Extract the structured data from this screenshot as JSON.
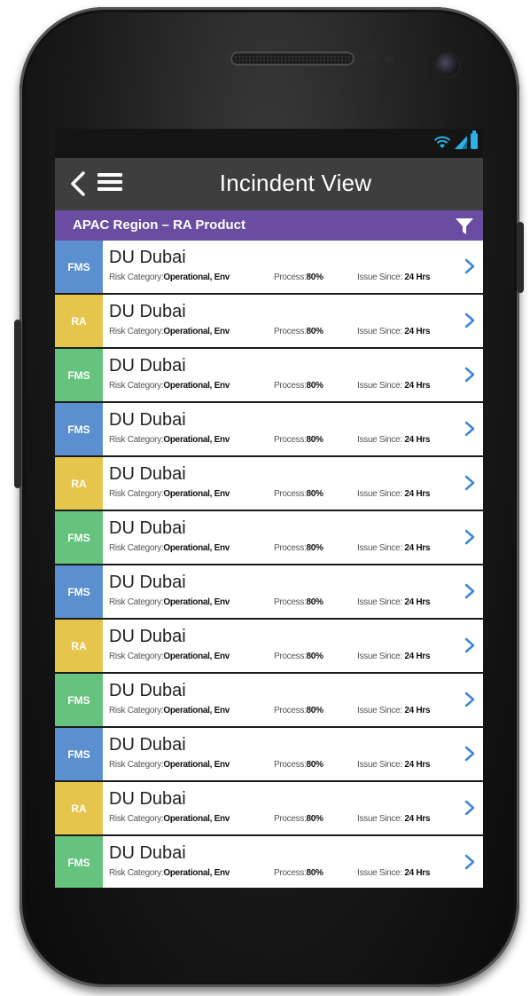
{
  "app": {
    "title": "Incindent View"
  },
  "filter": {
    "label": "APAC Region – RA Product"
  },
  "icons": {
    "back": "back-chevron-icon",
    "menu": "hamburger-menu-icon",
    "filter": "filter-funnel-icon",
    "row_chevron": "chevron-right-icon",
    "wifi": "wifi-icon",
    "signal": "cell-signal-icon",
    "battery": "battery-icon"
  },
  "colors": {
    "filter_bar": "#6a4da0",
    "app_bar": "#3e3e3e",
    "badge_blue": "#5b8fd0",
    "badge_yellow": "#e6c54c",
    "badge_green": "#66c37e",
    "chevron": "#3b86d6"
  },
  "labels": {
    "risk": "Risk Category:",
    "process": "Process:",
    "since": "Issue Since:"
  },
  "incidents": [
    {
      "badge": "FMS",
      "color": "#5b8fd0",
      "title": "DU Dubai",
      "risk": "Operational, Env",
      "process": "80%",
      "since": "24 Hrs"
    },
    {
      "badge": "RA",
      "color": "#e6c54c",
      "title": "DU Dubai",
      "risk": "Operational, Env",
      "process": "80%",
      "since": "24 Hrs"
    },
    {
      "badge": "FMS",
      "color": "#66c37e",
      "title": "DU Dubai",
      "risk": "Operational, Env",
      "process": "80%",
      "since": "24 Hrs"
    },
    {
      "badge": "FMS",
      "color": "#5b8fd0",
      "title": "DU Dubai",
      "risk": "Operational, Env",
      "process": "80%",
      "since": "24 Hrs"
    },
    {
      "badge": "RA",
      "color": "#e6c54c",
      "title": "DU Dubai",
      "risk": "Operational, Env",
      "process": "80%",
      "since": "24 Hrs"
    },
    {
      "badge": "FMS",
      "color": "#66c37e",
      "title": "DU Dubai",
      "risk": "Operational, Env",
      "process": "80%",
      "since": "24 Hrs"
    },
    {
      "badge": "FMS",
      "color": "#5b8fd0",
      "title": "DU Dubai",
      "risk": "Operational, Env",
      "process": "80%",
      "since": "24 Hrs"
    },
    {
      "badge": "RA",
      "color": "#e6c54c",
      "title": "DU Dubai",
      "risk": "Operational, Env",
      "process": "80%",
      "since": "24 Hrs"
    },
    {
      "badge": "FMS",
      "color": "#66c37e",
      "title": "DU Dubai",
      "risk": "Operational, Env",
      "process": "80%",
      "since": "24 Hrs"
    },
    {
      "badge": "FMS",
      "color": "#5b8fd0",
      "title": "DU Dubai",
      "risk": "Operational, Env",
      "process": "80%",
      "since": "24 Hrs"
    },
    {
      "badge": "RA",
      "color": "#e6c54c",
      "title": "DU Dubai",
      "risk": "Operational, Env",
      "process": "80%",
      "since": "24 Hrs"
    },
    {
      "badge": "FMS",
      "color": "#66c37e",
      "title": "DU Dubai",
      "risk": "Operational, Env",
      "process": "80%",
      "since": "24 Hrs"
    }
  ]
}
